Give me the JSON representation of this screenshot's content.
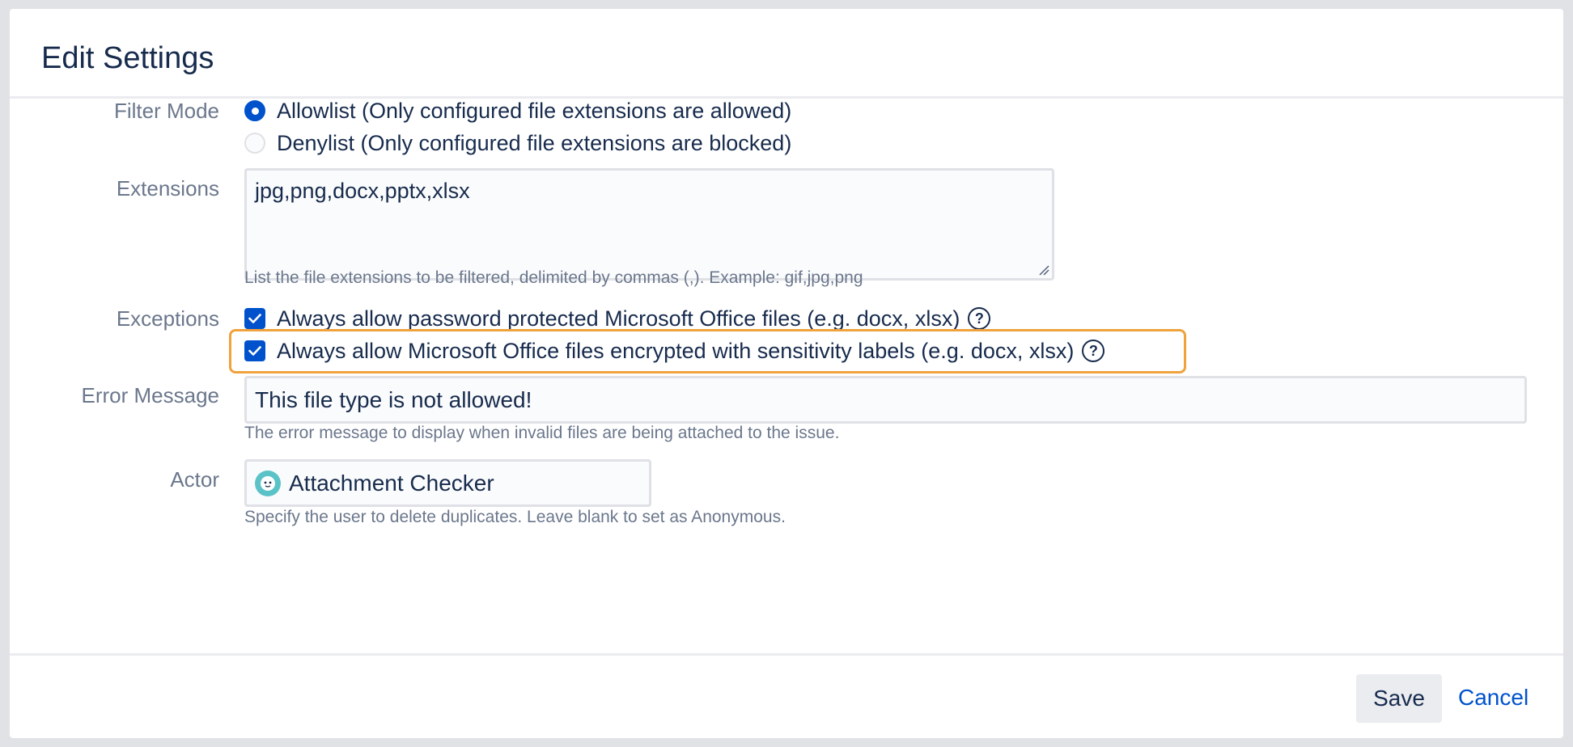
{
  "dialog": {
    "title": "Edit Settings"
  },
  "filter_mode": {
    "label": "Filter Mode",
    "options": [
      {
        "label": "Allowlist (Only configured file extensions are allowed)",
        "checked": true
      },
      {
        "label": "Denylist (Only configured file extensions are blocked)",
        "checked": false
      }
    ]
  },
  "extensions": {
    "label": "Extensions",
    "value": "jpg,png,docx,pptx,xlsx",
    "hint": "List the file extensions to be filtered, delimited by commas (,). Example: gif,jpg,png"
  },
  "exceptions": {
    "label": "Exceptions",
    "options": [
      {
        "label": "Always allow password protected Microsoft Office files (e.g. docx, xlsx)",
        "checked": true
      },
      {
        "label": "Always allow Microsoft Office files encrypted with sensitivity labels (e.g. docx, xlsx)",
        "checked": true
      }
    ],
    "help_glyph": "?"
  },
  "error_message": {
    "label": "Error Message",
    "value": "This file type is not allowed!",
    "hint": "The error message to display when invalid files are being attached to the issue."
  },
  "actor": {
    "label": "Actor",
    "value": "Attachment Checker",
    "hint": "Specify the user to delete duplicates. Leave blank to set as Anonymous."
  },
  "footer": {
    "save_label": "Save",
    "cancel_label": "Cancel"
  },
  "colors": {
    "primary": "#0052cc",
    "highlight": "#f0a23c",
    "label": "#6b778c",
    "text": "#172b4d",
    "avatar": "#5bc3c7"
  },
  "icons": {
    "help": "question-circle-icon",
    "check": "check-icon",
    "avatar": "robot-avatar-icon"
  }
}
